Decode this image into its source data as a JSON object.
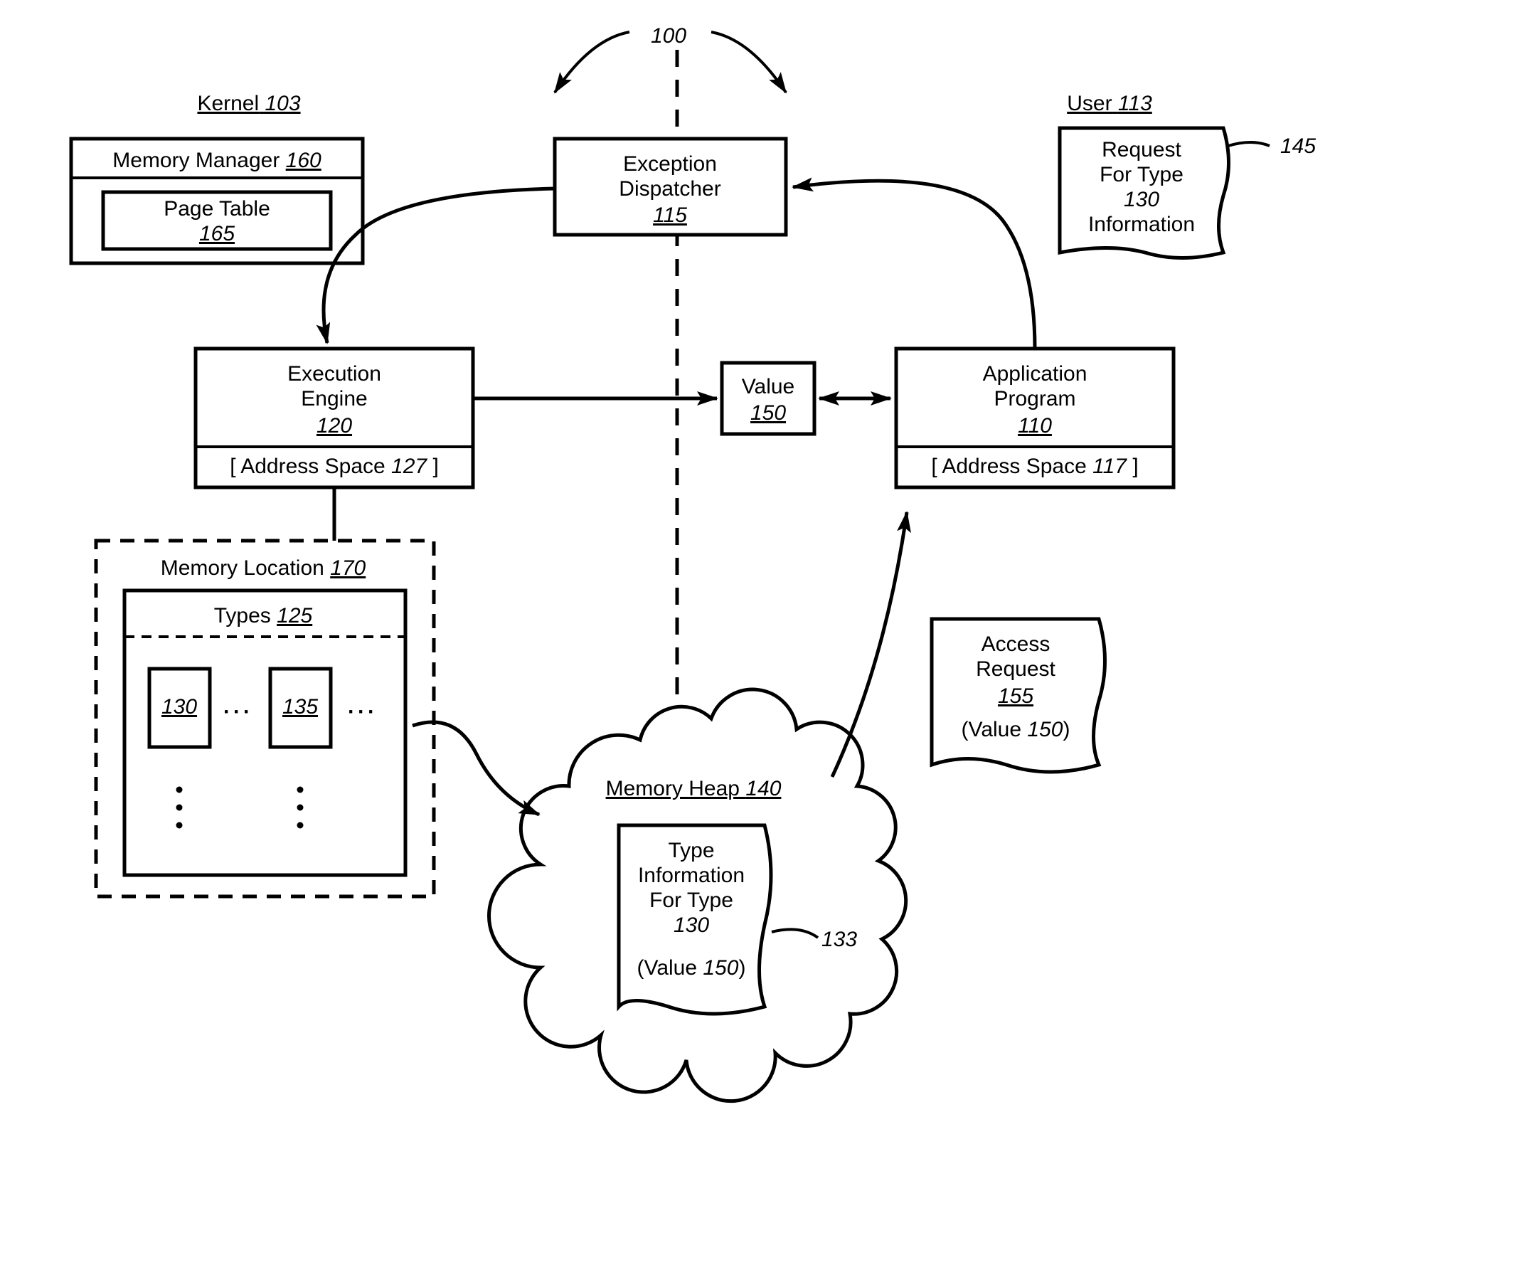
{
  "figure": {
    "ref100": "100",
    "kernel": {
      "label": "Kernel",
      "ref": "103"
    },
    "user": {
      "label": "User",
      "ref": "113"
    },
    "memory_manager": {
      "label": "Memory Manager",
      "ref": "160"
    },
    "page_table": {
      "label": "Page Table",
      "ref": "165"
    },
    "exception_dispatcher": {
      "label1": "Exception",
      "label2": "Dispatcher",
      "ref": "115"
    },
    "execution_engine": {
      "label1": "Execution",
      "label2": "Engine",
      "ref": "120",
      "address_space_label": "[ Address Space",
      "address_space_ref": "127",
      "address_space_close": "]"
    },
    "application_program": {
      "label1": "Application",
      "label2": "Program",
      "ref": "110",
      "address_space_label": "[ Address Space",
      "address_space_ref": "117",
      "address_space_close": "]"
    },
    "value_box": {
      "label": "Value",
      "ref": "150"
    },
    "memory_location": {
      "label": "Memory Location",
      "ref": "170"
    },
    "types": {
      "label": "Types",
      "ref": "125",
      "item1_ref": "130",
      "item2_ref": "135",
      "ellipsis": "···"
    },
    "memory_heap": {
      "label": "Memory Heap",
      "ref": "140",
      "type_info_l1": "Type",
      "type_info_l2": "Information",
      "type_info_l3": "For Type",
      "type_info_ref": "130",
      "value_text": "(Value 150)",
      "callout_ref": "133"
    },
    "request_note": {
      "l1": "Request",
      "l2": "For Type",
      "ref": "130",
      "l4": "Information",
      "callout_ref": "145"
    },
    "access_request": {
      "l1": "Access",
      "l2": "Request",
      "ref": "155",
      "value_text": "(Value 150)"
    }
  }
}
